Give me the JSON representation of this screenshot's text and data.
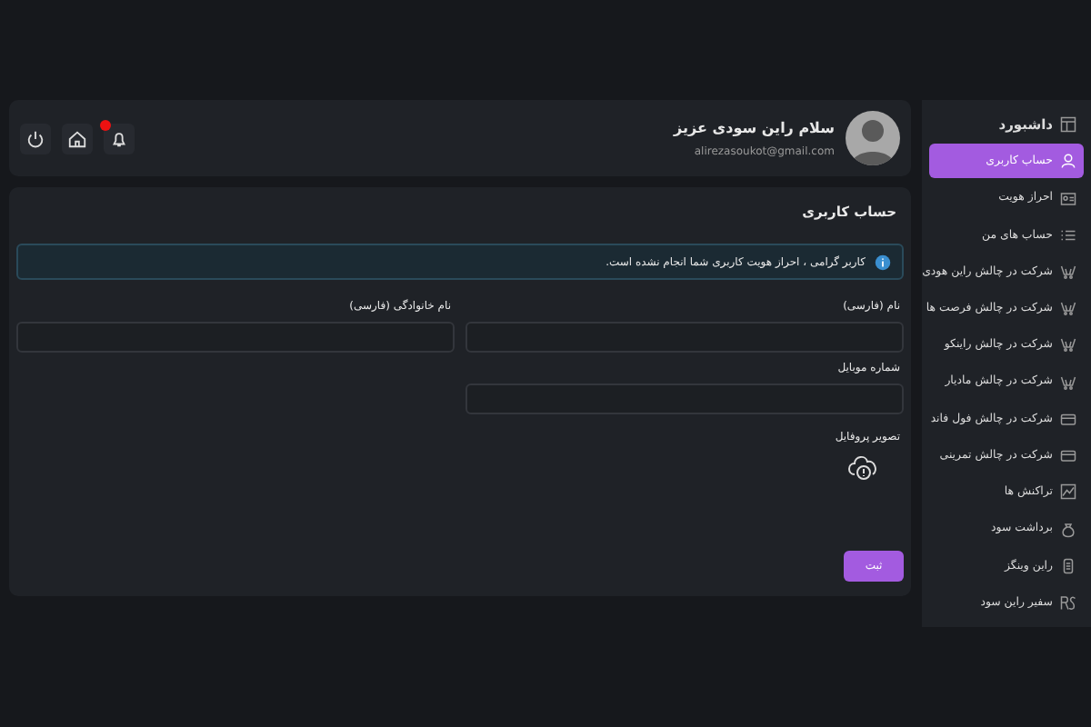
{
  "sidebar": {
    "items": [
      {
        "label": "داشبورد",
        "selected": false,
        "kind": "heading"
      },
      {
        "label": "حساب کاربری",
        "selected": true,
        "kind": "link"
      },
      {
        "label": "احراز هویت",
        "selected": false,
        "kind": "link"
      },
      {
        "label": "حساب های من",
        "selected": false,
        "kind": "link"
      },
      {
        "label": "شرکت در چالش راین هودی",
        "selected": false,
        "kind": "link"
      },
      {
        "label": "شرکت در چالش فرصت ها",
        "selected": false,
        "kind": "link"
      },
      {
        "label": "شرکت در چالش راینکو",
        "selected": false,
        "kind": "link"
      },
      {
        "label": "شرکت در چالش مادیار",
        "selected": false,
        "kind": "link"
      },
      {
        "label": "شرکت در چالش فول فاند",
        "selected": false,
        "kind": "link"
      },
      {
        "label": "شرکت در چالش تمرینی",
        "selected": false,
        "kind": "link"
      },
      {
        "label": "تراکنش ها",
        "selected": false,
        "kind": "link"
      },
      {
        "label": "برداشت سود",
        "selected": false,
        "kind": "link"
      },
      {
        "label": "راین وینگز",
        "selected": false,
        "kind": "link"
      },
      {
        "label": "سفیر راین سود",
        "selected": false,
        "kind": "link"
      }
    ]
  },
  "header": {
    "greeting": "سلام راین سودی عزیز",
    "email": "alirezasoukot@gmail.com",
    "notification_dot": true
  },
  "form": {
    "title": "حساب کاربری",
    "alert": "کاربر گرامی ، احراز هویت کاربری شما انجام نشده است.",
    "fields": [
      {
        "label": "نام (فارسی)"
      },
      {
        "label": "نام خانوادگی (فارسی)"
      },
      {
        "label": "شماره موبایل"
      }
    ],
    "upload_label": "تصویر پروفایل",
    "submit": "ثبت"
  }
}
